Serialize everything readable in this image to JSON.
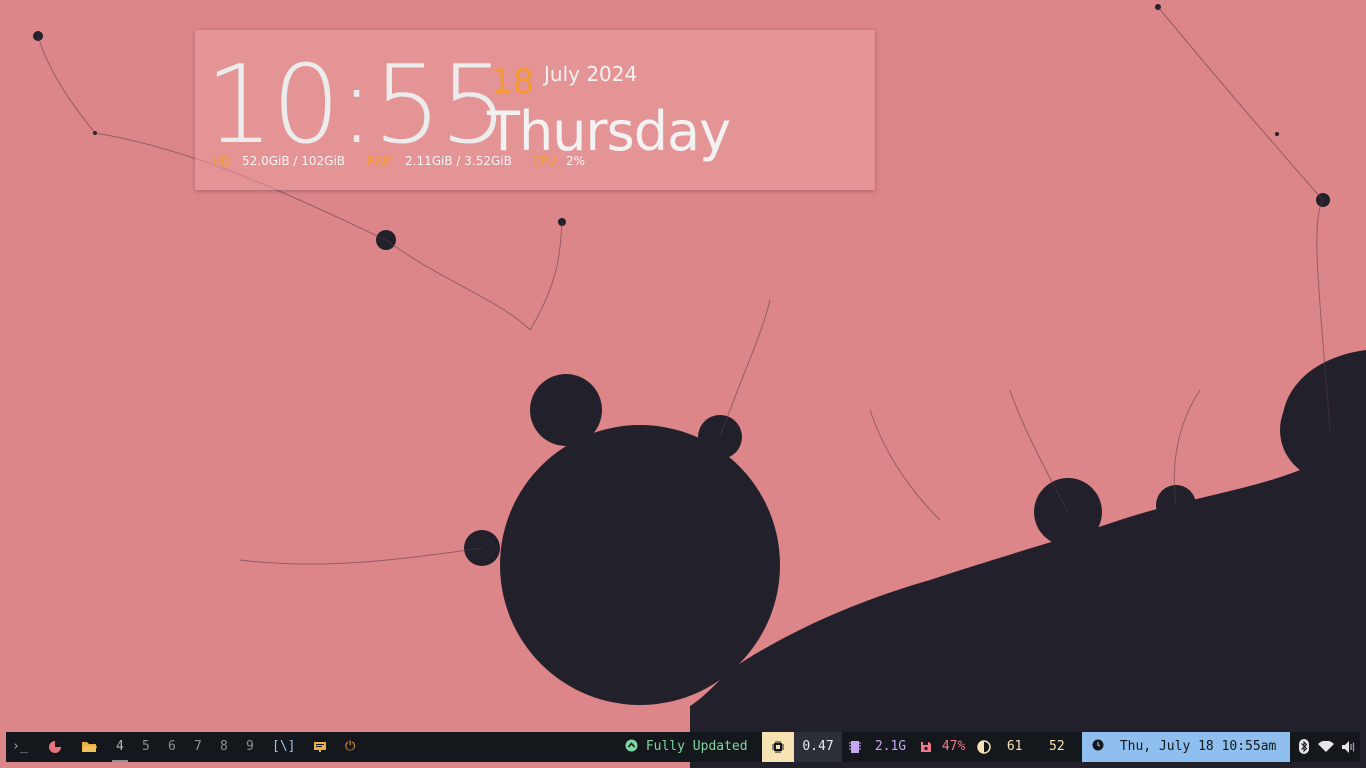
{
  "widget": {
    "time": "10:55",
    "day_number": "18",
    "month_year": "July 2024",
    "weekday": "Thursday",
    "stats": {
      "hd_label": "HD",
      "hd_value": "52.0GiB / 102GiB",
      "ram_label": "RAM",
      "ram_value": "2.11GiB / 3.52GiB",
      "cpu_label": "CPU",
      "cpu_value": "2%"
    }
  },
  "taskbar": {
    "launchers": [
      {
        "icon": "terminal-icon",
        "glyph": "›_"
      },
      {
        "icon": "browser-icon",
        "glyph": "◕"
      },
      {
        "icon": "folder-icon",
        "glyph": "▬"
      }
    ],
    "workspaces": [
      "4",
      "5",
      "6",
      "7",
      "8",
      "9"
    ],
    "active_workspace": "4",
    "layout_indicator": "[\\]",
    "updates": "Fully Updated",
    "load": "0.47",
    "memory": "2.1G",
    "disk": "47%",
    "brightness": "61",
    "temperature": "52",
    "datetime": "Thu, July 18 10:55am",
    "colors": {
      "bar_bg": "#14181d",
      "accent_orange": "#f39a30",
      "updates_green": "#7fd4a0",
      "memory_purple": "#c9a6f0",
      "disk_pink": "#f0788a",
      "date_block": "#8fbfef"
    }
  }
}
